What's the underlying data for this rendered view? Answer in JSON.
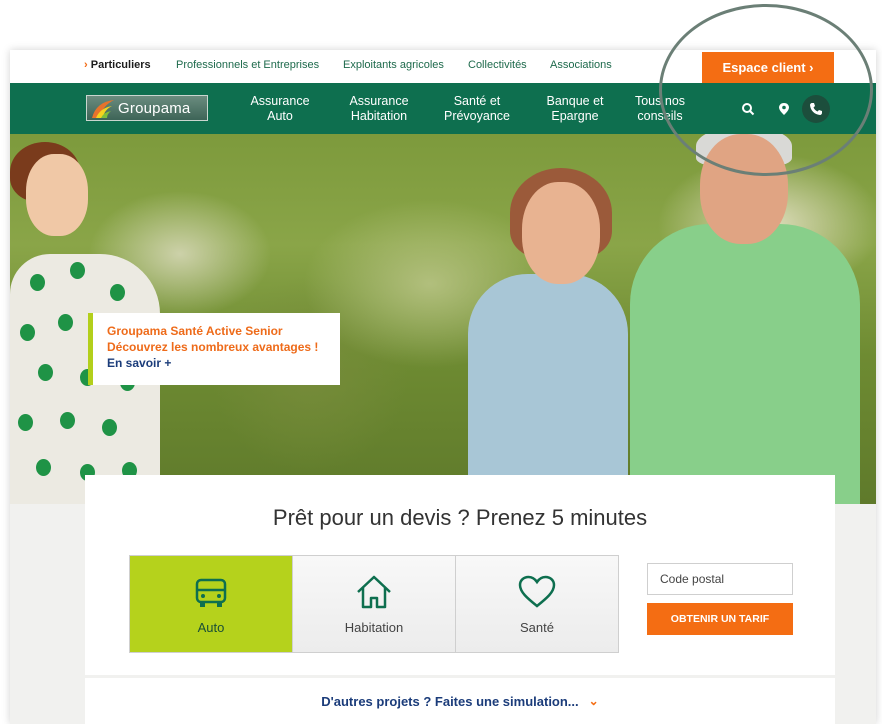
{
  "topbar": {
    "items": [
      {
        "label": "Particuliers"
      },
      {
        "label": "Professionnels et Entreprises"
      },
      {
        "label": "Exploitants agricoles"
      },
      {
        "label": "Collectivités"
      },
      {
        "label": "Associations"
      }
    ],
    "espace_client": "Espace client ›"
  },
  "nav": {
    "logo_text": "Groupama",
    "items": [
      {
        "line1": "Assurance",
        "line2": "Auto"
      },
      {
        "line1": "Assurance",
        "line2": "Habitation"
      },
      {
        "line1": "Santé et",
        "line2": "Prévoyance"
      },
      {
        "line1": "Banque et",
        "line2": "Epargne"
      },
      {
        "line1": "Tous nos",
        "line2": "conseils"
      }
    ],
    "icons": [
      "search-icon",
      "location-icon",
      "phone-icon"
    ]
  },
  "promo": {
    "line1": "Groupama Santé Active Senior",
    "line2": "Découvrez les nombreux avantages !",
    "link": "En savoir +"
  },
  "devis": {
    "title": "Prêt pour un devis ? Prenez 5 minutes",
    "tabs": [
      {
        "label": "Auto",
        "icon": "car-icon"
      },
      {
        "label": "Habitation",
        "icon": "house-icon"
      },
      {
        "label": "Santé",
        "icon": "heart-icon"
      }
    ],
    "postal_placeholder": "Code postal",
    "button": "OBTENIR UN TARIF"
  },
  "autres": {
    "label": "D'autres projets ? Faites une simulation...",
    "chevron": "⌄"
  },
  "colors": {
    "green": "#0e6f4f",
    "orange": "#f46d13",
    "lime": "#b5d21c",
    "navy": "#1b3c7a"
  }
}
